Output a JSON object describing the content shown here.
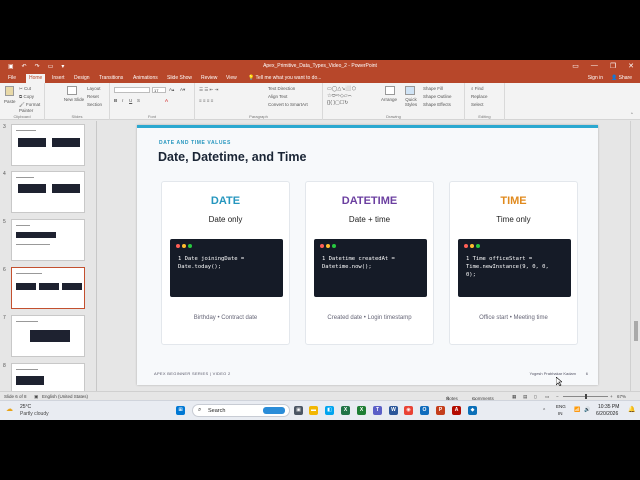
{
  "window": {
    "title": "Apex_Primitive_Data_Types_Video_2 - PowerPoint",
    "controls": [
      "—",
      "❐",
      "✕"
    ]
  },
  "tabs": [
    "File",
    "Home",
    "Insert",
    "Design",
    "Transitions",
    "Animations",
    "Slide Show",
    "Review",
    "View"
  ],
  "active_tab": "Home",
  "tellme": "Tell me what you want to do...",
  "signin": "Sign in",
  "share": "Share",
  "ribbon": {
    "clipboard": {
      "label": "Clipboard",
      "paste": "Paste",
      "cut": "Cut",
      "copy": "Copy",
      "format_painter": "Format Painter"
    },
    "slides": {
      "label": "Slides",
      "new_slide": "New Slide",
      "layout": "Layout",
      "reset": "Reset",
      "section": "Section"
    },
    "font": {
      "label": "Font",
      "size": "17"
    },
    "paragraph": {
      "label": "Paragraph",
      "text_direction": "Text Direction",
      "align_text": "Align Text",
      "smartart": "Convert to SmartArt"
    },
    "drawing": {
      "label": "Drawing",
      "arrange": "Arrange",
      "quick_styles": "Quick Styles",
      "shape_fill": "Shape Fill",
      "shape_outline": "Shape Outline",
      "shape_effects": "Shape Effects"
    },
    "editing": {
      "label": "Editing",
      "find": "Find",
      "replace": "Replace",
      "select": "Select"
    }
  },
  "thumbnails": [
    "3",
    "4",
    "5",
    "6",
    "7",
    "8"
  ],
  "slide": {
    "kicker": "DATE AND TIME VALUES",
    "title": "Date, Datetime, and Time",
    "cards": [
      {
        "title": "DATE",
        "color": "#2596be",
        "subtitle": "Date only",
        "code": "1 Date joiningDate =\nDate.today();",
        "footer": "Birthday • Contract date"
      },
      {
        "title": "DATETIME",
        "color": "#6b3fa0",
        "subtitle": "Date + time",
        "code": "1 Datetime createdAt =\nDatetime.now();",
        "footer": "Created date • Login timestamp"
      },
      {
        "title": "TIME",
        "color": "#e08a1e",
        "subtitle": "Time only",
        "code": "1 Time officeStart =\nTime.newInstance(9, 0, 0,\n0);",
        "footer": "Office start • Meeting time"
      }
    ],
    "footer_left": "APEX BEGINNER SERIES | VIDEO 2",
    "footer_right": "Yogesh Prabhakar Kadam",
    "page_number": "6"
  },
  "status": {
    "slide_of": "Slide 6 of 8",
    "language": "English (United States)",
    "notes": "Notes",
    "comments": "Comments",
    "zoom": "67%"
  },
  "taskbar": {
    "weather_temp": "25°C",
    "weather_desc": "Partly cloudy",
    "search": "Search",
    "lang": "ENG",
    "lang2": "IN",
    "time": "10:35 PM",
    "date": "6/20/2026"
  }
}
